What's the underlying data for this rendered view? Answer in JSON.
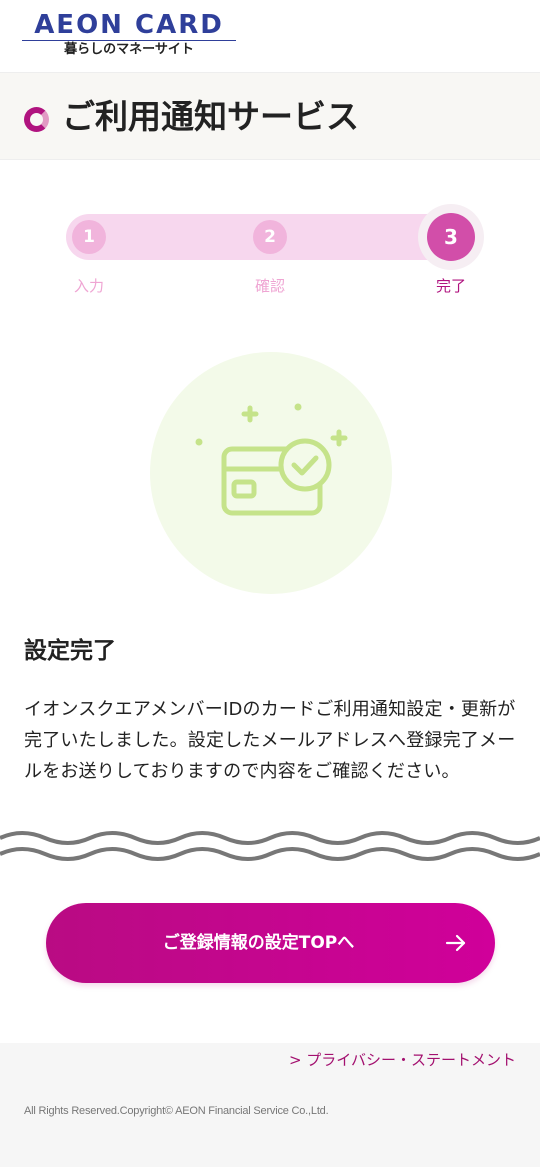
{
  "brand": {
    "logo_main": "AEON CARD",
    "logo_sub": "暮らしのマネーサイト",
    "colors": {
      "primary_magenta": "#b0137f",
      "logo_navy": "#2f3f9a",
      "illustration_green": "#c5e38a"
    }
  },
  "page": {
    "title": "ご利用通知サービス"
  },
  "stepper": {
    "current_step": 3,
    "steps": [
      {
        "number": "1",
        "label": "入力"
      },
      {
        "number": "2",
        "label": "確認"
      },
      {
        "number": "3",
        "label": "完了"
      }
    ]
  },
  "illustration": {
    "icon": "card-check-icon"
  },
  "completion": {
    "heading": "設定完了",
    "body": "イオンスクエアメンバーIDのカードご利用通知設定・更新が完了いたしました。設定したメールアドレスへ登録完了メールをお送りしておりますので内容をご確認ください。"
  },
  "cta": {
    "label": "ご登録情報の設定TOPへ",
    "icon": "arrow-right-icon"
  },
  "footer": {
    "privacy_link": "> プライバシー・ステートメント",
    "copyright": "All Rights Reserved.Copyright© AEON Financial Service Co.,Ltd."
  }
}
